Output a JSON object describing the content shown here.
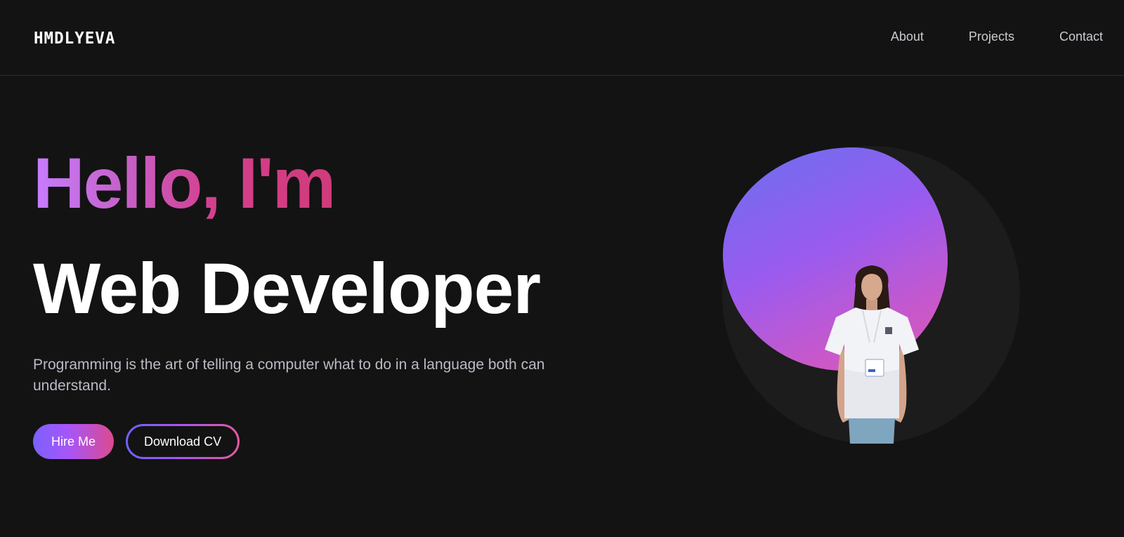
{
  "header": {
    "logo": "HMDLYEVA",
    "nav": [
      {
        "label": "About"
      },
      {
        "label": "Projects"
      },
      {
        "label": "Contact"
      }
    ]
  },
  "hero": {
    "greeting": "Hello, I'm",
    "title": "Web Developer",
    "description": "Programming is the art of telling a computer what to do in a language both can understand.",
    "buttons": {
      "hire": "Hire Me",
      "download": "Download CV"
    }
  },
  "colors": {
    "background": "#131313",
    "accent_purple": "#a855f7",
    "accent_pink": "#db4a8f",
    "accent_blue": "#7b61ff"
  }
}
